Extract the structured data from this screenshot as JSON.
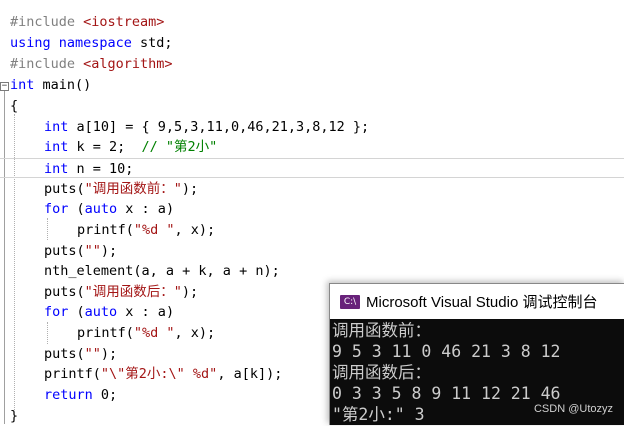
{
  "editor": {
    "lines": [
      {
        "segments": [
          {
            "t": "#include ",
            "c": "pp"
          },
          {
            "t": "<iostream>",
            "c": "str"
          }
        ]
      },
      {
        "segments": [
          {
            "t": "using namespace",
            "c": "kw"
          },
          {
            "t": " std;",
            "c": ""
          }
        ]
      },
      {
        "segments": [
          {
            "t": "#include ",
            "c": "pp"
          },
          {
            "t": "<algorithm>",
            "c": "str"
          }
        ]
      },
      {
        "segments": [
          {
            "t": "int",
            "c": "kw"
          },
          {
            "t": " main()",
            "c": ""
          }
        ]
      },
      {
        "segments": [
          {
            "t": "{",
            "c": ""
          }
        ]
      },
      {
        "segments": [
          {
            "t": "int",
            "c": "kw"
          },
          {
            "t": " a[10] = { 9,5,3,11,0,46,21,3,8,12 };",
            "c": ""
          }
        ]
      },
      {
        "segments": [
          {
            "t": "int",
            "c": "kw"
          },
          {
            "t": " k = 2;  ",
            "c": ""
          },
          {
            "t": "// \"第2小\"",
            "c": "cm"
          }
        ]
      },
      {
        "segments": [
          {
            "t": "int",
            "c": "kw"
          },
          {
            "t": " n = 10;",
            "c": ""
          }
        ]
      },
      {
        "segments": [
          {
            "t": "puts(",
            "c": ""
          },
          {
            "t": "\"调用函数前：\"",
            "c": "str"
          },
          {
            "t": ");",
            "c": ""
          }
        ]
      },
      {
        "segments": [
          {
            "t": "for",
            "c": "kw"
          },
          {
            "t": " (",
            "c": ""
          },
          {
            "t": "auto",
            "c": "kw"
          },
          {
            "t": " x : a)",
            "c": ""
          }
        ]
      },
      {
        "segments": [
          {
            "t": "printf(",
            "c": ""
          },
          {
            "t": "\"%d \"",
            "c": "str"
          },
          {
            "t": ", x);",
            "c": ""
          }
        ]
      },
      {
        "segments": [
          {
            "t": "puts(",
            "c": ""
          },
          {
            "t": "\"\"",
            "c": "str"
          },
          {
            "t": ");",
            "c": ""
          }
        ]
      },
      {
        "segments": [
          {
            "t": "nth_element(a, a + k, a + n);",
            "c": ""
          }
        ]
      },
      {
        "segments": [
          {
            "t": "puts(",
            "c": ""
          },
          {
            "t": "\"调用函数后：\"",
            "c": "str"
          },
          {
            "t": ");",
            "c": ""
          }
        ]
      },
      {
        "segments": [
          {
            "t": "for",
            "c": "kw"
          },
          {
            "t": " (",
            "c": ""
          },
          {
            "t": "auto",
            "c": "kw"
          },
          {
            "t": " x : a)",
            "c": ""
          }
        ]
      },
      {
        "segments": [
          {
            "t": "printf(",
            "c": ""
          },
          {
            "t": "\"%d \"",
            "c": "str"
          },
          {
            "t": ", x);",
            "c": ""
          }
        ]
      },
      {
        "segments": [
          {
            "t": "puts(",
            "c": ""
          },
          {
            "t": "\"\"",
            "c": "str"
          },
          {
            "t": ");",
            "c": ""
          }
        ]
      },
      {
        "segments": [
          {
            "t": "printf(",
            "c": ""
          },
          {
            "t": "\"\\\"第2小:\\\" %d\"",
            "c": "str"
          },
          {
            "t": ", a[k]);",
            "c": ""
          }
        ]
      },
      {
        "segments": [
          {
            "t": "return",
            "c": "kw"
          },
          {
            "t": " 0;",
            "c": ""
          }
        ]
      },
      {
        "segments": [
          {
            "t": "}",
            "c": ""
          }
        ]
      }
    ]
  },
  "console": {
    "icon_text": "C:\\",
    "title": "Microsoft Visual Studio 调试控制台",
    "lines": [
      "调用函数前：",
      "9 5 3 11 0 46 21 3 8 12",
      "调用函数后：",
      "0 3 3 5 8 9 11 12 21 46",
      "\"第2小:\" 3"
    ]
  },
  "watermark": "CSDN @Utozyz",
  "colors": {
    "keyword": "#0000ff",
    "preprocessor": "#808080",
    "string": "#a31515",
    "comment": "#008000",
    "console_bg": "#0c0c0c",
    "console_text": "#cccccc"
  }
}
